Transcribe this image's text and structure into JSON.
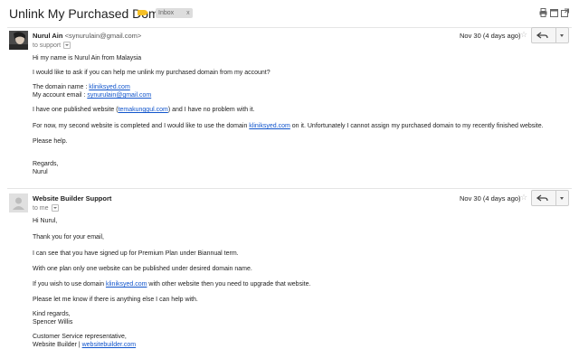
{
  "thread": {
    "subject": "Unlink My Purchased Domain",
    "label_chip": "Inbox",
    "label_chip_close": "x"
  },
  "toolbar_icons": [
    "print-icon",
    "new-window-icon",
    "popout-icon"
  ],
  "colors": {
    "link": "#1155cc",
    "label_yellow": "#f6c026"
  },
  "messages": [
    {
      "sender_name": "Nurul Ain",
      "sender_email": "<synurulain@gmail.com>",
      "recipient": "to support",
      "date": "Nov 30 (4 days ago)",
      "body": {
        "greeting": "Hi my name is Nurul Ain from Malaysia",
        "request": "I would like to ask if you can help me unlink my purchased domain from my account?",
        "domain_name_prefix": "The domain name : ",
        "domain_name_link": "kliniksyed.com",
        "account_email_prefix": "My account email : ",
        "account_email_link": "synurulain@gmail.com",
        "published_prefix": "I have one published website (",
        "published_link": "temakunggul.com",
        "published_suffix": ") and I have no problem with it.",
        "second_prefix": "For now, my second website is completed and I would like to use the domain ",
        "second_link": "kliniksyed.com",
        "second_suffix": " on it. Unfortunately I cannot assign my purchased domain to my recently finished website.",
        "please_help": "Please help.",
        "regards": "Regards,",
        "signature": "Nurul"
      }
    },
    {
      "sender_name": "Website Builder Support",
      "recipient": "to me",
      "date": "Nov 30 (4 days ago)",
      "body": {
        "greeting": "Hi Nurul,",
        "thanks": "Thank you for your email,",
        "signed_up": "I can see that you have signed up for Premium Plan under Biannual term.",
        "one_plan": "With one plan only one website can be published under desired domain name.",
        "wish_prefix": "If you wish to use domain ",
        "wish_link": "kliniksyed.com",
        "wish_suffix": " with other website then you need to upgrade that website.",
        "let_me_know": "Please let me know if there is anything else I can help with.",
        "kind_regards": "Kind regards,",
        "agent_name": "Spencer Willis",
        "role": "Customer Service representative,",
        "company_prefix": "Website Builder | ",
        "company_link": "websitebuilder.com"
      }
    }
  ]
}
